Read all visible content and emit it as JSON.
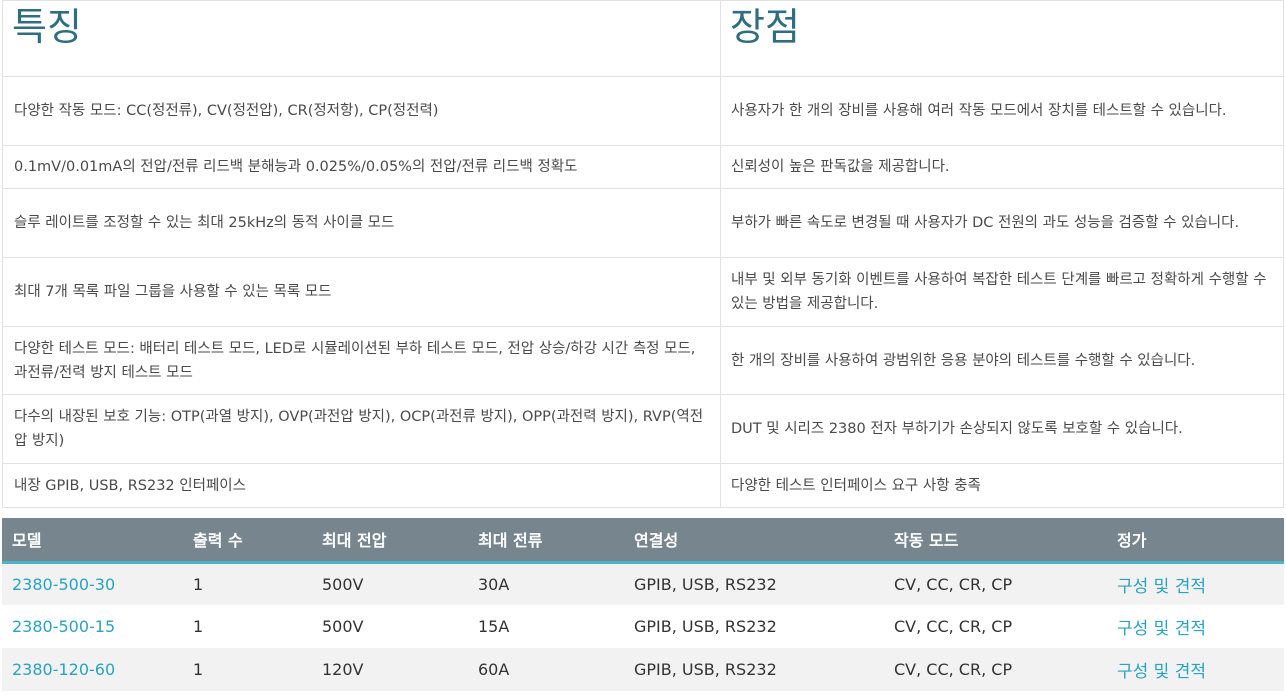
{
  "features": {
    "header_features": "특징",
    "header_benefits": "장점",
    "rows": [
      {
        "feature": "다양한 작동 모드: CC(정전류), CV(정전압), CR(정저항), CP(정전력)",
        "benefit": "사용자가 한 개의 장비를 사용해 여러 작동 모드에서 장치를 테스트할 수 있습니다."
      },
      {
        "feature": "0.1mV/0.01mA의 전압/전류 리드백 분해능과 0.025%/0.05%의 전압/전류 리드백 정확도",
        "benefit": "신뢰성이 높은 판독값을 제공합니다."
      },
      {
        "feature": "슬루 레이트를 조정할 수 있는 최대 25kHz의 동적 사이클 모드",
        "benefit": "부하가 빠른 속도로 변경될 때 사용자가 DC 전원의 과도 성능을 검증할 수 있습니다."
      },
      {
        "feature": "최대 7개 목록 파일 그룹을 사용할 수 있는 목록 모드",
        "benefit": "내부 및 외부 동기화 이벤트를 사용하여 복잡한 테스트 단계를 빠르고 정확하게 수행할 수 있는 방법을 제공합니다."
      },
      {
        "feature": "다양한 테스트 모드: 배터리 테스트 모드, LED로 시뮬레이션된 부하 테스트 모드, 전압 상승/하강 시간 측정 모드, 과전류/전력 방지 테스트 모드",
        "benefit": "한 개의 장비를 사용하여 광범위한 응용 분야의 테스트를 수행할 수 있습니다."
      },
      {
        "feature": "다수의 내장된 보호 기능: OTP(과열 방지), OVP(과전압 방지), OCP(과전류 방지), OPP(과전력 방지), RVP(역전압 방지)",
        "benefit": "DUT 및 시리즈 2380 전자 부하기가 손상되지 않도록 보호할 수 있습니다."
      },
      {
        "feature": "내장 GPIB, USB, RS232 인터페이스",
        "benefit": "다양한 테스트 인터페이스 요구 사항 충족"
      }
    ]
  },
  "models": {
    "columns": [
      "모델",
      "출력 수",
      "최대 전압",
      "최대 전류",
      "연결성",
      "작동 모드",
      "정가"
    ],
    "rows": [
      {
        "model": "2380-500-30",
        "outputs": "1",
        "max_voltage": "500V",
        "max_current": "30A",
        "connectivity": "GPIB, USB, RS232",
        "modes": "CV, CC, CR, CP",
        "price": "구성 및 견적"
      },
      {
        "model": "2380-500-15",
        "outputs": "1",
        "max_voltage": "500V",
        "max_current": "15A",
        "connectivity": "GPIB, USB, RS232",
        "modes": "CV, CC, CR, CP",
        "price": "구성 및 견적"
      },
      {
        "model": "2380-120-60",
        "outputs": "1",
        "max_voltage": "120V",
        "max_current": "60A",
        "connectivity": "GPIB, USB, RS232",
        "modes": "CV, CC, CR, CP",
        "price": "구성 및 견적"
      }
    ]
  },
  "colors": {
    "heading": "#2f6e80",
    "table_header_bg": "#77858f",
    "table_header_border": "#46b6c9",
    "link": "#2aa2c1"
  }
}
